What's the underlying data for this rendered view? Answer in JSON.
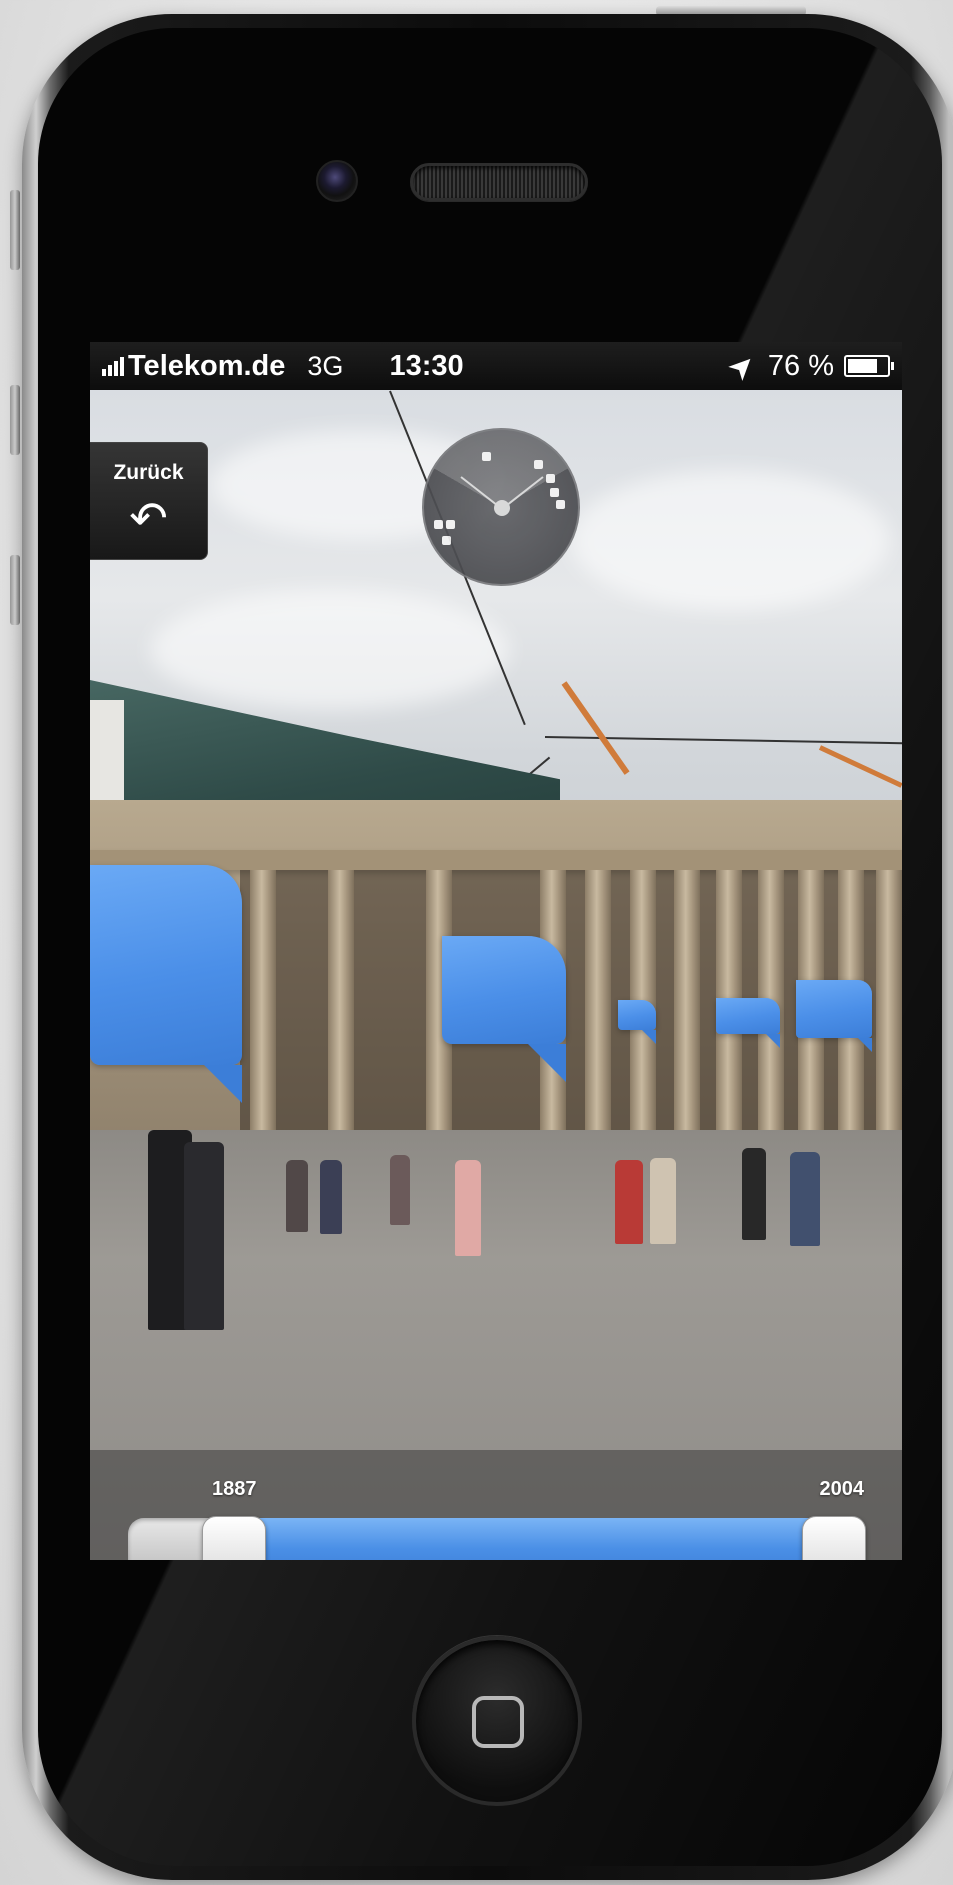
{
  "status_bar": {
    "carrier": "Telekom.de",
    "network": "3G",
    "time": "13:30",
    "battery": "76 %",
    "battery_level": 0.76,
    "location_icon": "location-arrow-icon",
    "signal_icon": "signal-bars-icon"
  },
  "navigation": {
    "back_label": "Zurück",
    "back_icon": "undo-arrow-icon"
  },
  "radar": {
    "icon": "radar-compass-icon"
  },
  "timeline": {
    "start_year": "1887",
    "end_year": "2004"
  },
  "colors": {
    "bubble_blue": "#4b8fe8",
    "slider_fill": "#4a8fe6",
    "status_bar_bg": "#1e1e1e"
  },
  "hardware": {
    "home_icon": "home-button-icon"
  }
}
